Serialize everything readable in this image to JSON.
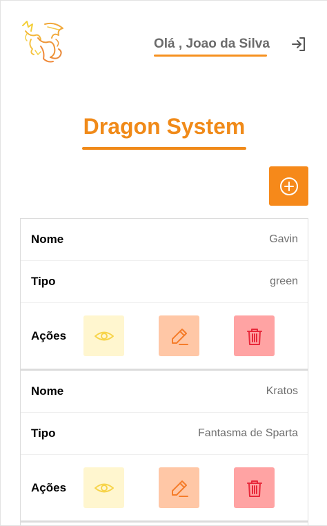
{
  "header": {
    "greeting": "Olá , Joao da Silva",
    "logo_icon": "dragon-logo",
    "logout_icon": "logout-icon"
  },
  "page": {
    "title": "Dragon System"
  },
  "colors": {
    "accent": "#f08a19",
    "view_bg": "#fff6cf",
    "edit_bg": "#ffc7a6",
    "delete_bg": "#ffa3a3"
  },
  "labels": {
    "name": "Nome",
    "type": "Tipo",
    "actions": "Ações"
  },
  "dragons": [
    {
      "name": "Gavin",
      "type": "green"
    },
    {
      "name": "Kratos",
      "type": "Fantasma de Sparta"
    }
  ]
}
